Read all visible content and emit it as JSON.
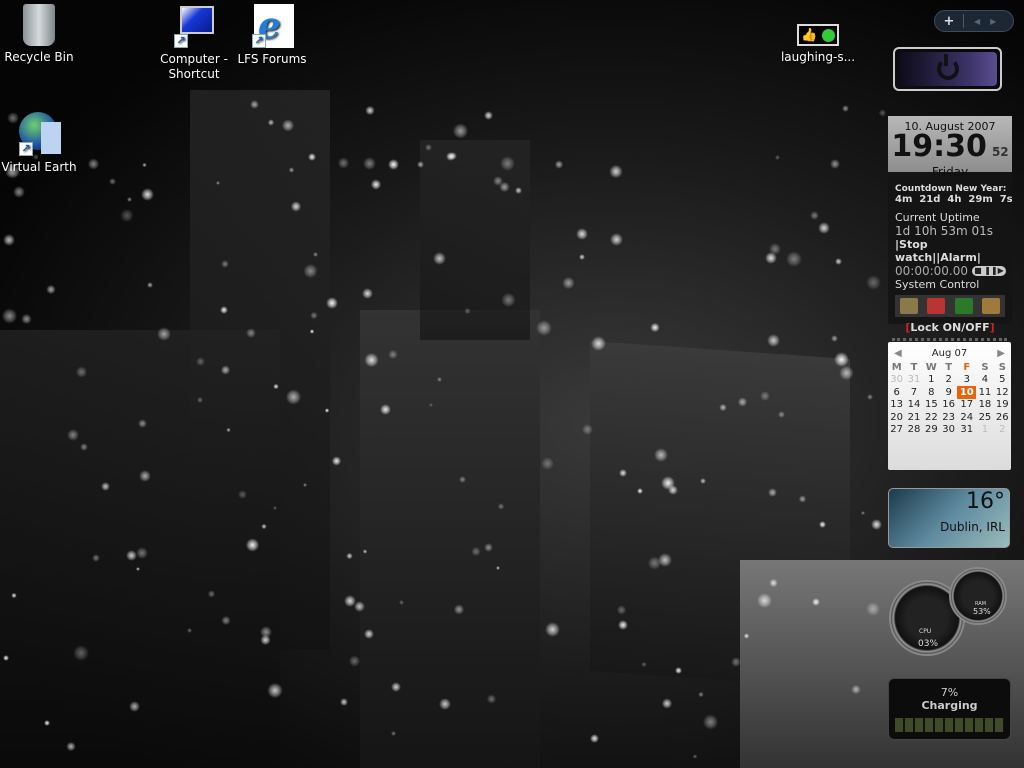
{
  "desktop_icons": [
    {
      "label": "Recycle Bin",
      "icon": "recycle-bin-icon"
    },
    {
      "label": "Computer - Shortcut",
      "icon": "computer-icon"
    },
    {
      "label": "LFS Forums",
      "icon": "internet-explorer-icon"
    },
    {
      "label": "Virtual Earth",
      "icon": "virtual-earth-icon"
    },
    {
      "label": "laughing-s...",
      "icon": "smiley-image-icon"
    }
  ],
  "sidebar_controls": {
    "add": "+",
    "prev": "◀",
    "next": "▶"
  },
  "clock": {
    "date": "10. August 2007",
    "time": "19:30",
    "seconds": "52",
    "day": "Friday",
    "countdown_label": "Countdown New Year:",
    "countdown": "4m  21d  4h  29m  7s",
    "uptime_label": "Current Uptime",
    "uptime": "1d 10h 53m 01s",
    "links": "|Stop watch||Alarm|",
    "stopwatch": "00:00:00.00",
    "system_label": "System Control",
    "lock": "Lock ON/OFF"
  },
  "calendar": {
    "month": "Aug 07",
    "weekdays": [
      "M",
      "T",
      "W",
      "T",
      "F",
      "S",
      "S"
    ],
    "today": "10",
    "highlight_color": "#e8640c",
    "weeks": [
      [
        "30",
        "31",
        "1",
        "2",
        "3",
        "4",
        "5"
      ],
      [
        "6",
        "7",
        "8",
        "9",
        "10",
        "11",
        "12"
      ],
      [
        "13",
        "14",
        "15",
        "16",
        "17",
        "18",
        "19"
      ],
      [
        "20",
        "21",
        "22",
        "23",
        "24",
        "25",
        "26"
      ],
      [
        "27",
        "28",
        "29",
        "30",
        "31",
        "1",
        "2"
      ]
    ]
  },
  "weather": {
    "temp": "16°",
    "location": "Dublin, IRL"
  },
  "meters": {
    "cpu_label": "CPU",
    "cpu": "03%",
    "ram_label": "RAM",
    "ram": "53%"
  },
  "battery": {
    "percent": "7%",
    "status": "Charging",
    "level": 7
  }
}
